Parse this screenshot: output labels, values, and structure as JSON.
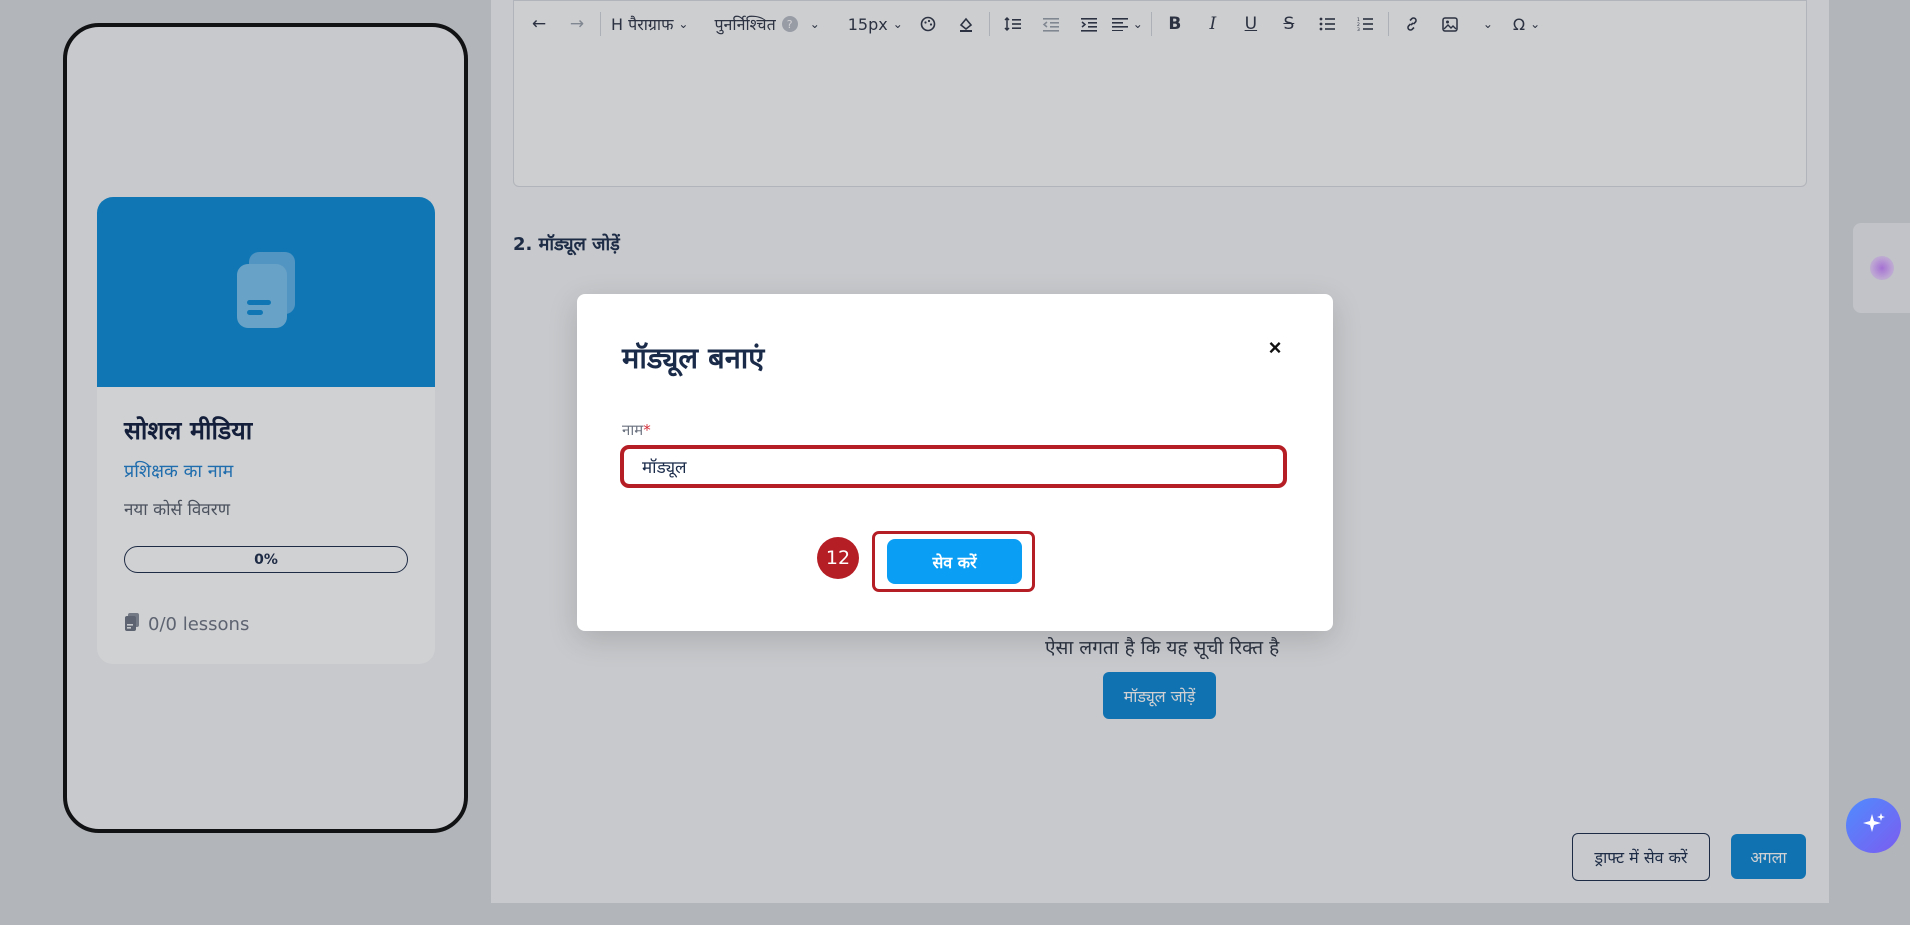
{
  "preview": {
    "course_title": "सोशल मीडिया",
    "trainer_name": "प्रशिक्षक का नाम",
    "description": "नया कोर्स विवरण",
    "progress_label": "0%",
    "progress_value": 0,
    "lessons_label": "0/0 lessons",
    "banner_color": "#0a8cd8"
  },
  "toolbar": {
    "undo_icon": "arrow-left",
    "redo_icon": "arrow-right",
    "heading_prefix": "H",
    "paragraph_label": "पैराग्राफ",
    "default_font_label": "पुनर्निश्चित",
    "font_help": "?",
    "font_size_label": "15px",
    "bold_label": "B",
    "italic_label": "I",
    "underline_label": "U",
    "strike_label": "S",
    "omega_label": "Ω"
  },
  "section": {
    "title": "2. मॉड्यूल जोड़ें",
    "empty_text": "ऐसा लगता है कि यह सूची रिक्त है",
    "add_module_label": "मॉड्यूल जोड़ें"
  },
  "footer": {
    "save_draft_label": "ड्राफ्ट में सेव करें",
    "next_label": "अगला"
  },
  "modal": {
    "title": "मॉड्यूल बनाएं",
    "close_label": "×",
    "name_label": "नाम",
    "required_mark": "*",
    "name_value": "मॉड्यूल",
    "save_label": "सेव करें",
    "step_number": "12",
    "highlight_color": "#b61e26"
  },
  "colors": {
    "primary": "#0b86d4",
    "save_button": "#0a9ef4",
    "text_dark": "#1a2b4a"
  }
}
